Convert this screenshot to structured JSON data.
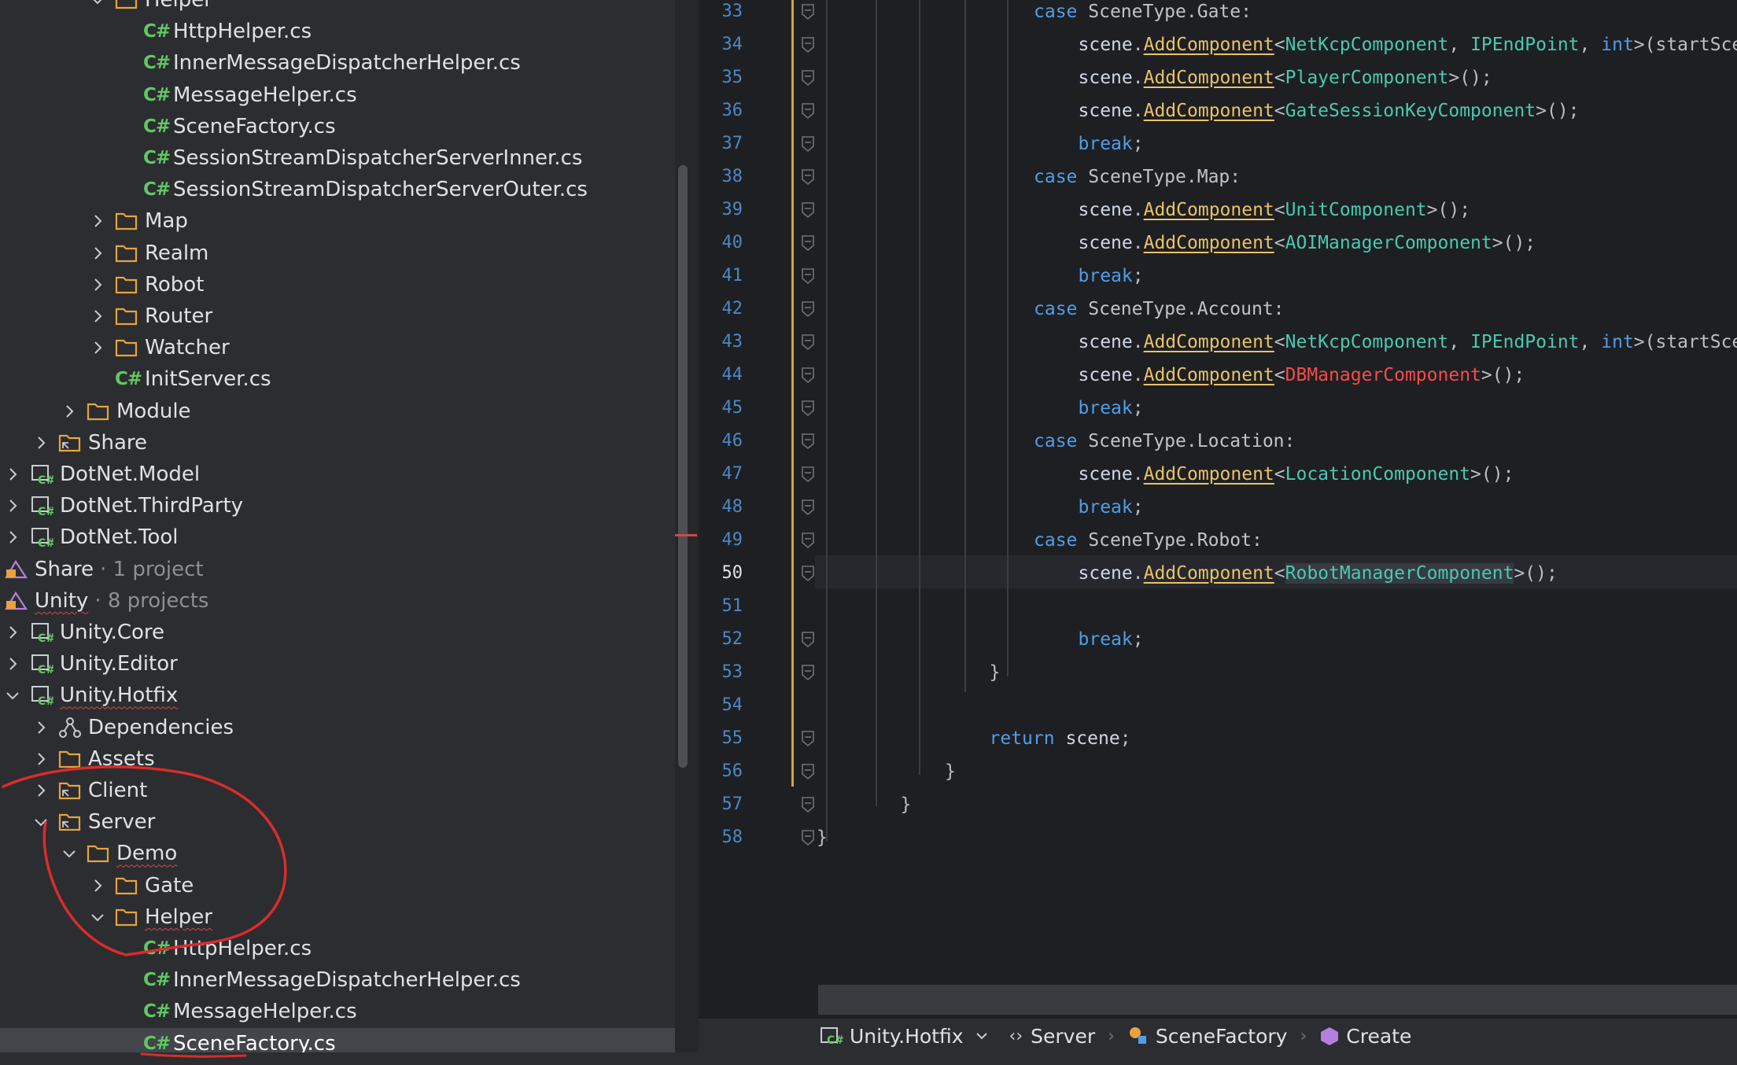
{
  "tree": {
    "rows": [
      {
        "label": "Helper",
        "type": "folder",
        "depth": 3,
        "expanded": true
      },
      {
        "label": "HttpHelper.cs",
        "type": "cs",
        "depth": 4
      },
      {
        "label": "InnerMessageDispatcherHelper.cs",
        "type": "cs",
        "depth": 4
      },
      {
        "label": "MessageHelper.cs",
        "type": "cs",
        "depth": 4
      },
      {
        "label": "SceneFactory.cs",
        "type": "cs",
        "depth": 4
      },
      {
        "label": "SessionStreamDispatcherServerInner.cs",
        "type": "cs",
        "depth": 4
      },
      {
        "label": "SessionStreamDispatcherServerOuter.cs",
        "type": "cs",
        "depth": 4
      },
      {
        "label": "Map",
        "type": "folder",
        "depth": 3,
        "expanded": false
      },
      {
        "label": "Realm",
        "type": "folder",
        "depth": 3,
        "expanded": false
      },
      {
        "label": "Robot",
        "type": "folder",
        "depth": 3,
        "expanded": false
      },
      {
        "label": "Router",
        "type": "folder",
        "depth": 3,
        "expanded": false
      },
      {
        "label": "Watcher",
        "type": "folder",
        "depth": 3,
        "expanded": false
      },
      {
        "label": "InitServer.cs",
        "type": "cs",
        "depth": 3
      },
      {
        "label": "Module",
        "type": "folder",
        "depth": 2,
        "expanded": false
      },
      {
        "label": "Share",
        "type": "linked-folder",
        "depth": 1,
        "expanded": false
      },
      {
        "label": "DotNet.Model",
        "type": "project",
        "depth": 0,
        "expanded": false
      },
      {
        "label": "DotNet.ThirdParty",
        "type": "project",
        "depth": 0,
        "expanded": false
      },
      {
        "label": "DotNet.Tool",
        "type": "project",
        "depth": 0,
        "expanded": false
      },
      {
        "label": "Share",
        "type": "solution-folder",
        "depth": -1,
        "suffix": "· 1 project"
      },
      {
        "label": "Unity",
        "type": "solution-folder",
        "depth": -1,
        "suffix": "· 8 projects",
        "wavy": true
      },
      {
        "label": "Unity.Core",
        "type": "project",
        "depth": 0,
        "expanded": false
      },
      {
        "label": "Unity.Editor",
        "type": "project",
        "depth": 0,
        "expanded": false
      },
      {
        "label": "Unity.Hotfix",
        "type": "project",
        "depth": 0,
        "expanded": true,
        "wavy": true
      },
      {
        "label": "Dependencies",
        "type": "deps",
        "depth": 1,
        "expanded": false
      },
      {
        "label": "Assets",
        "type": "folder",
        "depth": 1,
        "expanded": false
      },
      {
        "label": "Client",
        "type": "linked-folder",
        "depth": 1,
        "expanded": false
      },
      {
        "label": "Server",
        "type": "linked-folder",
        "depth": 1,
        "expanded": true
      },
      {
        "label": "Demo",
        "type": "folder",
        "depth": 2,
        "expanded": true,
        "wavy": true
      },
      {
        "label": "Gate",
        "type": "folder",
        "depth": 3,
        "expanded": false
      },
      {
        "label": "Helper",
        "type": "folder",
        "depth": 3,
        "expanded": true,
        "wavy": true
      },
      {
        "label": "HttpHelper.cs",
        "type": "cs",
        "depth": 4
      },
      {
        "label": "InnerMessageDispatcherHelper.cs",
        "type": "cs",
        "depth": 4
      },
      {
        "label": "MessageHelper.cs",
        "type": "cs",
        "depth": 4
      },
      {
        "label": "SceneFactory.cs",
        "type": "cs",
        "depth": 4,
        "selected": true
      }
    ],
    "cs_glyph": "C#"
  },
  "editor": {
    "current_line": "50",
    "lines": [
      {
        "n": "33",
        "ind": 5,
        "t": [
          [
            "kw",
            "case "
          ],
          [
            "cls",
            "SceneType"
          ],
          [
            "",
            "."
          ],
          [
            "cls",
            "Gate"
          ],
          [
            "",
            ":"
          ]
        ]
      },
      {
        "n": "34",
        "ind": 6,
        "t": [
          [
            "var",
            "scene"
          ],
          [
            "",
            "."
          ],
          [
            "meth",
            "AddComponent"
          ],
          [
            "",
            "<"
          ],
          [
            "comp",
            "NetKcpComponent"
          ],
          [
            "",
            ", "
          ],
          [
            "comp",
            "IPEndPoint"
          ],
          [
            "",
            ", "
          ],
          [
            "kw",
            "int"
          ],
          [
            "",
            ">(startSce"
          ]
        ]
      },
      {
        "n": "35",
        "ind": 6,
        "t": [
          [
            "var",
            "scene"
          ],
          [
            "",
            "."
          ],
          [
            "meth",
            "AddComponent"
          ],
          [
            "",
            "<"
          ],
          [
            "comp",
            "PlayerComponent"
          ],
          [
            "",
            ">();"
          ]
        ]
      },
      {
        "n": "36",
        "ind": 6,
        "t": [
          [
            "var",
            "scene"
          ],
          [
            "",
            "."
          ],
          [
            "meth",
            "AddComponent"
          ],
          [
            "",
            "<"
          ],
          [
            "comp",
            "GateSessionKeyComponent"
          ],
          [
            "",
            ">();"
          ]
        ]
      },
      {
        "n": "37",
        "ind": 6,
        "t": [
          [
            "kw",
            "break"
          ],
          [
            "",
            ";"
          ]
        ]
      },
      {
        "n": "38",
        "ind": 5,
        "t": [
          [
            "kw",
            "case "
          ],
          [
            "cls",
            "SceneType"
          ],
          [
            "",
            "."
          ],
          [
            "cls",
            "Map"
          ],
          [
            "",
            ":"
          ]
        ]
      },
      {
        "n": "39",
        "ind": 6,
        "t": [
          [
            "var",
            "scene"
          ],
          [
            "",
            "."
          ],
          [
            "meth",
            "AddComponent"
          ],
          [
            "",
            "<"
          ],
          [
            "comp",
            "UnitComponent"
          ],
          [
            "",
            ">();"
          ]
        ]
      },
      {
        "n": "40",
        "ind": 6,
        "t": [
          [
            "var",
            "scene"
          ],
          [
            "",
            "."
          ],
          [
            "meth",
            "AddComponent"
          ],
          [
            "",
            "<"
          ],
          [
            "comp",
            "AOIManagerComponent"
          ],
          [
            "",
            ">();"
          ]
        ]
      },
      {
        "n": "41",
        "ind": 6,
        "t": [
          [
            "kw",
            "break"
          ],
          [
            "",
            ";"
          ]
        ]
      },
      {
        "n": "42",
        "ind": 5,
        "t": [
          [
            "kw",
            "case "
          ],
          [
            "cls",
            "SceneType"
          ],
          [
            "",
            "."
          ],
          [
            "cls",
            "Account"
          ],
          [
            "",
            ":"
          ]
        ]
      },
      {
        "n": "43",
        "ind": 6,
        "t": [
          [
            "var",
            "scene"
          ],
          [
            "",
            "."
          ],
          [
            "meth",
            "AddComponent"
          ],
          [
            "",
            "<"
          ],
          [
            "comp",
            "NetKcpComponent"
          ],
          [
            "",
            ", "
          ],
          [
            "comp",
            "IPEndPoint"
          ],
          [
            "",
            ", "
          ],
          [
            "kw",
            "int"
          ],
          [
            "",
            ">(startSce"
          ]
        ]
      },
      {
        "n": "44",
        "ind": 6,
        "t": [
          [
            "var",
            "scene"
          ],
          [
            "",
            "."
          ],
          [
            "meth",
            "AddComponent"
          ],
          [
            "",
            "<"
          ],
          [
            "err",
            "DBManagerComponent"
          ],
          [
            "",
            ">();"
          ]
        ]
      },
      {
        "n": "45",
        "ind": 6,
        "t": [
          [
            "kw",
            "break"
          ],
          [
            "",
            ";"
          ]
        ]
      },
      {
        "n": "46",
        "ind": 5,
        "t": [
          [
            "kw",
            "case "
          ],
          [
            "cls",
            "SceneType"
          ],
          [
            "",
            "."
          ],
          [
            "cls",
            "Location"
          ],
          [
            "",
            ":"
          ]
        ]
      },
      {
        "n": "47",
        "ind": 6,
        "t": [
          [
            "var",
            "scene"
          ],
          [
            "",
            "."
          ],
          [
            "meth",
            "AddComponent"
          ],
          [
            "",
            "<"
          ],
          [
            "comp",
            "LocationComponent"
          ],
          [
            "",
            ">();"
          ]
        ]
      },
      {
        "n": "48",
        "ind": 6,
        "t": [
          [
            "kw",
            "break"
          ],
          [
            "",
            ";"
          ]
        ]
      },
      {
        "n": "49",
        "ind": 5,
        "t": [
          [
            "kw",
            "case "
          ],
          [
            "cls",
            "SceneType"
          ],
          [
            "",
            "."
          ],
          [
            "cls",
            "Robot"
          ],
          [
            "",
            ":"
          ]
        ]
      },
      {
        "n": "50",
        "ind": 6,
        "t": [
          [
            "var",
            "scene"
          ],
          [
            "",
            "."
          ],
          [
            "meth",
            "AddComponent"
          ],
          [
            "",
            "<"
          ],
          [
            "comp hl",
            "RobotManagerComponent"
          ],
          [
            "",
            ">();"
          ]
        ]
      },
      {
        "n": "51",
        "ind": 6,
        "t": []
      },
      {
        "n": "52",
        "ind": 6,
        "t": [
          [
            "kw",
            "break"
          ],
          [
            "",
            ";"
          ]
        ]
      },
      {
        "n": "53",
        "ind": 4,
        "t": [
          [
            "",
            "}"
          ]
        ]
      },
      {
        "n": "54",
        "ind": 4,
        "t": []
      },
      {
        "n": "55",
        "ind": 4,
        "t": [
          [
            "kw",
            "return "
          ],
          [
            "var",
            "scene"
          ],
          [
            "",
            ";"
          ]
        ]
      },
      {
        "n": "56",
        "ind": 3,
        "t": [
          [
            "",
            "}"
          ]
        ]
      },
      {
        "n": "57",
        "ind": 2,
        "t": [
          [
            "",
            "}"
          ]
        ]
      },
      {
        "n": "58",
        "ind": 0,
        "t": [
          [
            "",
            "}"
          ]
        ]
      }
    ]
  },
  "breadcrumb": {
    "project": "Unity.Hotfix",
    "namespace": "Server",
    "class": "SceneFactory",
    "method": "Create"
  },
  "colors": {
    "folder": "#e8a33d",
    "cs": "#62c763",
    "keyword": "#4f9ee8",
    "component": "#4ac9b0",
    "method": "#e8c368",
    "error": "#f44c4c",
    "annotation": "#d92c2c"
  }
}
